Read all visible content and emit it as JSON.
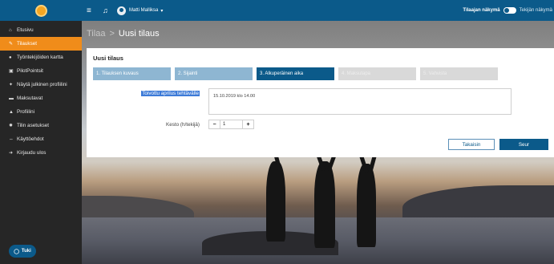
{
  "header": {
    "user_name": "Matti Malliksa",
    "user_chevron": "▾",
    "view_label_active": "Tilaajan näkymä",
    "view_label_other": "Tekijän näkymä"
  },
  "sidebar": {
    "items": [
      {
        "label": "Etusivu",
        "icon": "home-icon",
        "glyph": "⌂",
        "active": false
      },
      {
        "label": "Tilaukset",
        "icon": "edit-icon",
        "glyph": "✎",
        "active": true
      },
      {
        "label": "Työntekijöiden kartta",
        "icon": "map-pin-icon",
        "glyph": "●",
        "active": false
      },
      {
        "label": "PilotPointsit",
        "icon": "gift-icon",
        "glyph": "▣",
        "active": false
      },
      {
        "label": "Näytä julkinen profiilini",
        "icon": "eye-icon",
        "glyph": "✦",
        "active": false
      },
      {
        "label": "Maksutavat",
        "icon": "credit-card-icon",
        "glyph": "▬",
        "active": false
      },
      {
        "label": "Profiilini",
        "icon": "user-icon",
        "glyph": "▲",
        "active": false
      },
      {
        "label": "Tilin asetukset",
        "icon": "gear-icon",
        "glyph": "✹",
        "active": false
      },
      {
        "label": "Käyttöehdot",
        "icon": "handshake-icon",
        "glyph": "⇔",
        "active": false
      },
      {
        "label": "Kirjaudu ulos",
        "icon": "logout-icon",
        "glyph": "➜",
        "active": false
      }
    ],
    "support_label": "Tuki"
  },
  "breadcrumb": {
    "parent": "Tilaa",
    "separator": ">",
    "current": "Uusi tilaus"
  },
  "form": {
    "title": "Uusi tilaus",
    "steps": [
      {
        "label": "1. Tilauksen kuvaus",
        "state": "done"
      },
      {
        "label": "2. Sijainti",
        "state": "done"
      },
      {
        "label": "3. Alkuperäinen aika",
        "state": "current"
      },
      {
        "label": "4. Maksutapa",
        "state": "future"
      },
      {
        "label": "5. Vahvista",
        "state": "future"
      }
    ],
    "deadline_label": "Toivottu aprilus tehtävälle",
    "deadline_value": "15.10.2019 klo 14.00",
    "duration_label": "Kesto (h/tekijä)",
    "duration_value": "1",
    "minus": "−",
    "plus": "+",
    "back_label": "Takaisin",
    "next_label": "Seur"
  },
  "colors": {
    "primary": "#0b5a8a",
    "active_nav": "#f08c1a",
    "step_done": "#8eb6d2",
    "step_future": "#d9d9d9"
  }
}
